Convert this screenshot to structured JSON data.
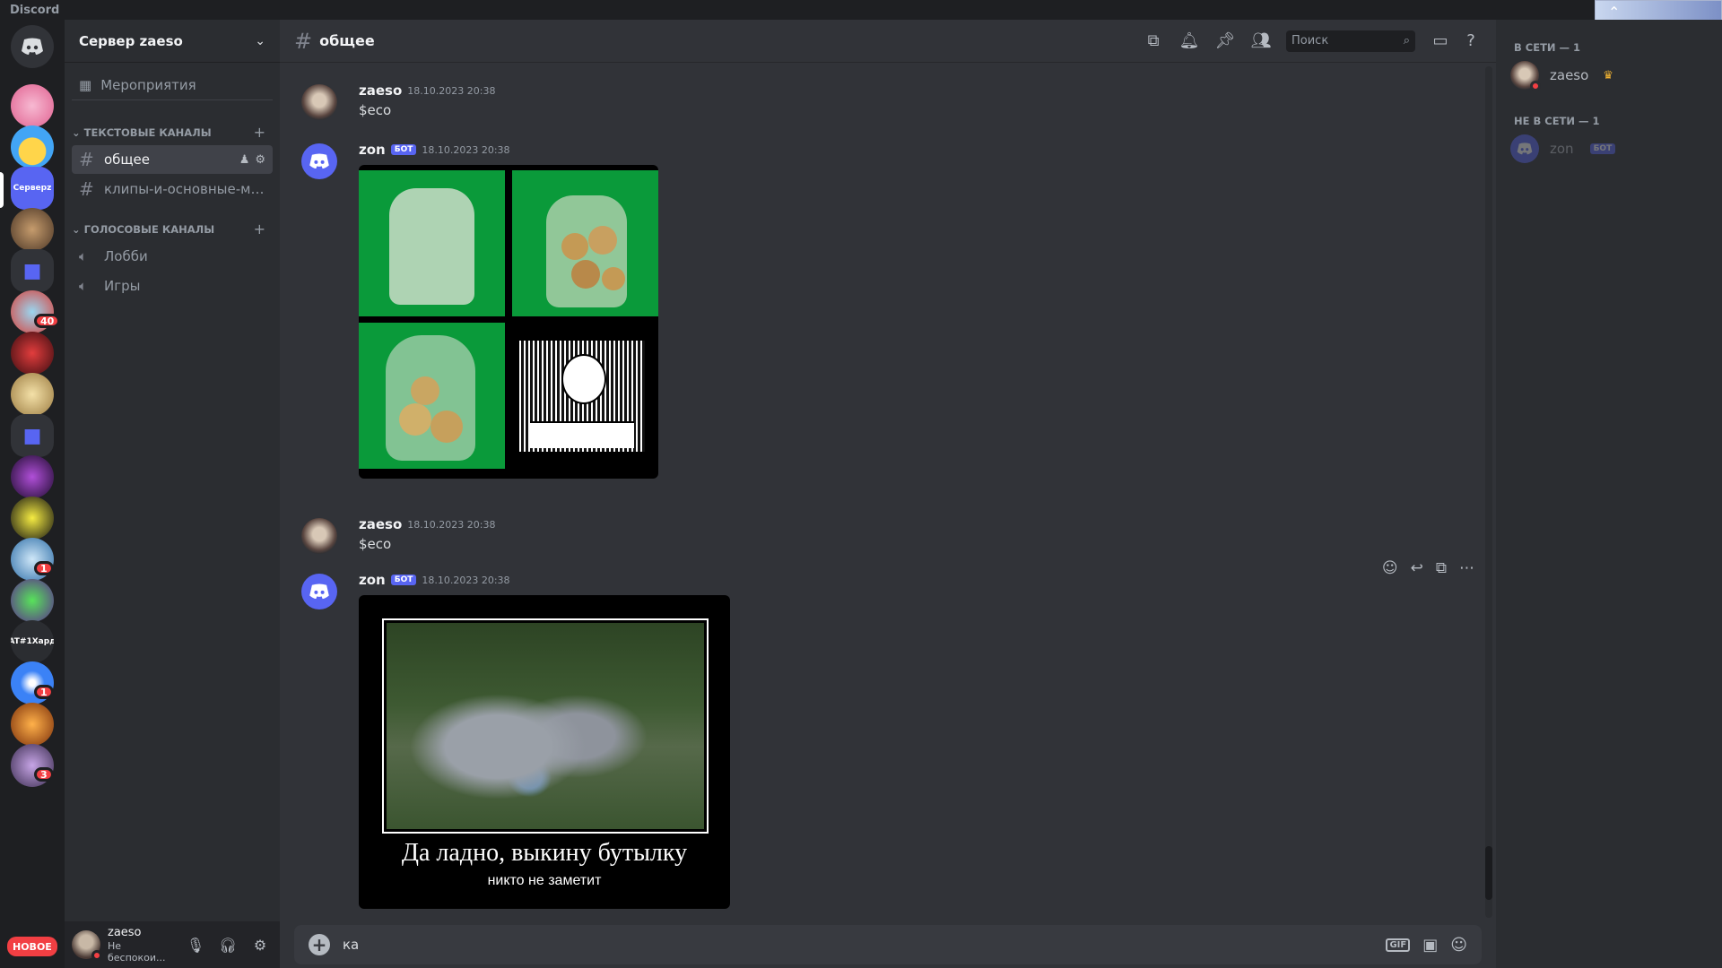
{
  "window": {
    "app_name": "Discord"
  },
  "guilds": {
    "server_label": "Серверz",
    "ath_label": "AT#1Хард",
    "badges": [
      "40",
      "1",
      "1",
      "3"
    ],
    "new_label": "НОВОЕ"
  },
  "sidebar": {
    "server_name": "Сервер zaeso",
    "events_label": "Мероприятия",
    "text_category": "Текстовые каналы",
    "voice_category": "Голосовые каналы",
    "text_channels": [
      {
        "name": "общее"
      },
      {
        "name": "клипы-и-основные-мо..."
      }
    ],
    "voice_channels": [
      {
        "name": "Лобби"
      },
      {
        "name": "Игры"
      }
    ]
  },
  "user_panel": {
    "name": "zaeso",
    "status": "Не беспокои..."
  },
  "channel": {
    "name": "общее",
    "search_placeholder": "Поиск"
  },
  "messages": [
    {
      "author": "zaeso",
      "time": "18.10.2023 20:38",
      "text": "$eco"
    },
    {
      "author": "zon",
      "bot_label": "БОТ",
      "time": "18.10.2023 20:38"
    },
    {
      "author": "zaeso",
      "time": "18.10.2023 20:38",
      "text": "$eco"
    },
    {
      "author": "zon",
      "bot_label": "БОТ",
      "time": "18.10.2023 20:38",
      "caption_main": "Да ладно, выкину бутылку",
      "caption_sub": "никто не заметит"
    }
  ],
  "composer": {
    "value": "ка",
    "gif_label": "GIF"
  },
  "members": {
    "online_header": "В сети — 1",
    "offline_header": "Не в сети — 1",
    "online": [
      {
        "name": "zaeso"
      }
    ],
    "offline": [
      {
        "name": "zon",
        "bot_label": "БОТ"
      }
    ]
  },
  "colors": {
    "accent": "#5865f2",
    "dnd": "#f23f43",
    "crown": "#f0b232"
  }
}
